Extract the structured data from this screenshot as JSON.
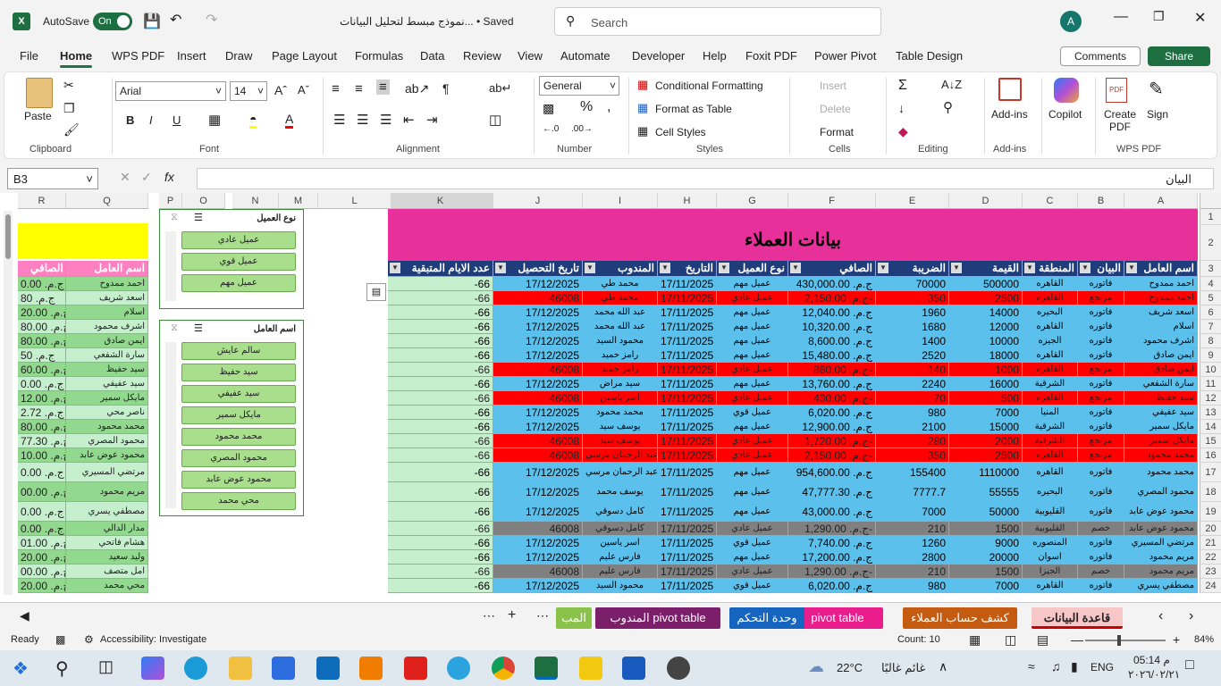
{
  "titlebar": {
    "autosave_label": "AutoSave",
    "autosave_state": "On",
    "doc_title": "نموذج مبسط لتحليل البيانات... • Saved",
    "search_placeholder": "Search",
    "user_initial": "A"
  },
  "menu": [
    "File",
    "Home",
    "WPS PDF",
    "Insert",
    "Draw",
    "Page Layout",
    "Formulas",
    "Data",
    "Review",
    "View",
    "Automate",
    "Developer",
    "Help",
    "Foxit PDF",
    "Power Pivot",
    "Table Design"
  ],
  "menu_active": "Home",
  "comments_label": "Comments",
  "share_label": "Share",
  "ribbon": {
    "paste": "Paste",
    "clipboard": "Clipboard",
    "font_name": "Arial",
    "font_size": "14",
    "font": "Font",
    "alignment": "Alignment",
    "number_format": "General",
    "number": "Number",
    "cond_format": "Conditional Formatting",
    "format_table": "Format as Table",
    "cell_styles": "Cell Styles",
    "styles": "Styles",
    "insert": "Insert",
    "delete": "Delete",
    "format": "Format",
    "cells": "Cells",
    "editing": "Editing",
    "addins": "Add-ins",
    "addins_group": "Add-ins",
    "copilot": "Copilot",
    "create_pdf": "Create PDF",
    "sign": "Sign",
    "wps_pdf": "WPS PDF",
    "bold": "B",
    "italic": "I",
    "underline": "U"
  },
  "formula": {
    "namebox": "B3",
    "content": "البيان"
  },
  "grid": {
    "right_cols": [
      {
        "id": "A",
        "w": 82
      },
      {
        "id": "B",
        "w": 52
      },
      {
        "id": "C",
        "w": 62
      },
      {
        "id": "D",
        "w": 82
      },
      {
        "id": "E",
        "w": 82
      },
      {
        "id": "F",
        "w": 98
      },
      {
        "id": "G",
        "w": 80
      },
      {
        "id": "H",
        "w": 66
      },
      {
        "id": "I",
        "w": 84
      },
      {
        "id": "J",
        "w": 100
      },
      {
        "id": "K",
        "w": 118
      }
    ],
    "title": "بيانات العملاء",
    "headers": [
      "اسم العامل",
      "البيان",
      "المنطقة",
      "القيمة",
      "الضريبة",
      "الصافي",
      "نوع العميل",
      "التاريخ",
      "المندوب",
      "تاريخ التحصيل",
      "عدد الايام المتبقية"
    ],
    "rows": [
      {
        "n": "4",
        "t": "b",
        "v": [
          "احمد ممدوح",
          "فاتوره",
          "القاهره",
          "500000",
          "70000",
          "ج.م. 430,000.00",
          "عميل مهم",
          "17/11/2025",
          "محمد طي",
          "17/12/2025",
          "-66"
        ]
      },
      {
        "n": "5",
        "t": "r",
        "v": [
          "احمد ممدوح",
          "مرتجع",
          "القاهره",
          "2500",
          "350",
          "ج.م. 2,150.00-",
          "عميل عادي",
          "17/11/2025",
          "محمد طي",
          "46008",
          "-66"
        ]
      },
      {
        "n": "6",
        "t": "b",
        "v": [
          "اسعد شريف",
          "فاتوره",
          "البحيره",
          "14000",
          "1960",
          "ج.م. 12,040.00",
          "عميل مهم",
          "17/11/2025",
          "عبد الله محمد",
          "17/12/2025",
          "-66"
        ]
      },
      {
        "n": "7",
        "t": "b",
        "v": [
          "اسلام",
          "فاتوره",
          "القاهره",
          "12000",
          "1680",
          "ج.م. 10,320.00",
          "عميل مهم",
          "17/11/2025",
          "عبد الله محمد",
          "17/12/2025",
          "-66"
        ]
      },
      {
        "n": "8",
        "t": "b",
        "v": [
          "اشرف محمود",
          "فاتوره",
          "الجيزه",
          "10000",
          "1400",
          "ج.م. 8,600.00",
          "عميل مهم",
          "17/11/2025",
          "محمود السيد",
          "17/12/2025",
          "-66"
        ]
      },
      {
        "n": "9",
        "t": "b",
        "v": [
          "ايمن صادق",
          "فاتوره",
          "القاهره",
          "18000",
          "2520",
          "ج.م. 15,480.00",
          "عميل مهم",
          "17/11/2025",
          "رامز حميد",
          "17/12/2025",
          "-66"
        ]
      },
      {
        "n": "10",
        "t": "r",
        "v": [
          "ايمن صادق",
          "مرتجع",
          "القاهره",
          "1000",
          "140",
          "ج.م. 860.00-",
          "عميل عادي",
          "17/11/2025",
          "رامز حميد",
          "46008",
          "-66"
        ]
      },
      {
        "n": "11",
        "t": "b",
        "v": [
          "سارة الشفعي",
          "فاتوره",
          "الشرقية",
          "16000",
          "2240",
          "ج.م. 13,760.00",
          "عميل مهم",
          "17/11/2025",
          "سيد مراض",
          "17/12/2025",
          "-66"
        ]
      },
      {
        "n": "12",
        "t": "r",
        "v": [
          "سيد حفيظ",
          "مرتجع",
          "القاهره",
          "500",
          "70",
          "ج.م. 430.00-",
          "عميل عادي",
          "17/11/2025",
          "اسر ياسين",
          "46008",
          "-66"
        ]
      },
      {
        "n": "13",
        "t": "b",
        "v": [
          "سيد عفيفي",
          "فاتوره",
          "المنيا",
          "7000",
          "980",
          "ج.م. 6,020.00",
          "عميل قوي",
          "17/11/2025",
          "محمد محمود",
          "17/12/2025",
          "-66"
        ]
      },
      {
        "n": "14",
        "t": "b",
        "v": [
          "مايكل سمير",
          "فاتوره",
          "الشرقية",
          "15000",
          "2100",
          "ج.م. 12,900.00",
          "عميل مهم",
          "17/11/2025",
          "يوسف سيد",
          "17/12/2025",
          "-66"
        ]
      },
      {
        "n": "15",
        "t": "r",
        "v": [
          "مايكل سمير",
          "مرتجع",
          "الشرقية",
          "2000",
          "280",
          "ج.م. 1,720.00-",
          "عميل عادي",
          "17/11/2025",
          "يوسف سيد",
          "46008",
          "-66"
        ]
      },
      {
        "n": "16",
        "t": "r",
        "v": [
          "محمد محمود",
          "مرتجع",
          "القاهره",
          "2500",
          "350",
          "ج.م. 2,150.00-",
          "عميل عادي",
          "17/11/2025",
          "عبد الرحمان مرسي",
          "46008",
          "-66"
        ]
      },
      {
        "n": "17",
        "t": "b",
        "v": [
          "محمد محمود",
          "فاتوره",
          "القاهره",
          "1110000",
          "155400",
          "ج.م. 954,600.00",
          "عميل مهم",
          "17/11/2025",
          "عبد الرحمان مرسي",
          "17/12/2025",
          "-66"
        ]
      },
      {
        "n": "18",
        "t": "b",
        "v": [
          "محمود المصري",
          "فاتوره",
          "البحيره",
          "55555",
          "7777.7",
          "ج.م. 47,777.30",
          "عميل مهم",
          "17/11/2025",
          "يوسف محمد",
          "17/12/2025",
          "-66"
        ]
      },
      {
        "n": "19",
        "t": "b",
        "v": [
          "محمود عوض عابد",
          "فاتوره",
          "القليوبية",
          "50000",
          "7000",
          "ج.م. 43,000.00",
          "عميل مهم",
          "17/11/2025",
          "كامل دسوقي",
          "17/12/2025",
          "-66"
        ]
      },
      {
        "n": "20",
        "t": "g",
        "v": [
          "محمود عوض عابد",
          "خصم",
          "القليوبية",
          "1500",
          "210",
          "ج.م. 1,290.00-",
          "عميل عادي",
          "17/11/2025",
          "كامل دسوقي",
          "46008",
          "-66"
        ]
      },
      {
        "n": "21",
        "t": "b",
        "v": [
          "مرتضي المسيري",
          "فاتوره",
          "المنصوره",
          "9000",
          "1260",
          "ج.م. 7,740.00",
          "عميل قوي",
          "17/11/2025",
          "اسر ياسين",
          "17/12/2025",
          "-66"
        ]
      },
      {
        "n": "22",
        "t": "b",
        "v": [
          "مريم محمود",
          "فاتوره",
          "اسوان",
          "20000",
          "2800",
          "ج.م. 17,200.00",
          "عميل مهم",
          "17/11/2025",
          "فارس عليم",
          "17/12/2025",
          "-66"
        ]
      },
      {
        "n": "23",
        "t": "g",
        "v": [
          "مريم محمود",
          "خصم",
          "الجيزا",
          "1500",
          "210",
          "ج.م. 1,290.00-",
          "عميل عادي",
          "17/11/2025",
          "فارس عليم",
          "46008",
          "-66"
        ]
      },
      {
        "n": "24",
        "t": "b",
        "v": [
          "مصطفي يسري",
          "فاتوره",
          "القاهره",
          "7000",
          "980",
          "ج.م. 6,020.00",
          "عميل قوي",
          "17/11/2025",
          "محمود السيد",
          "17/12/2025",
          "-66"
        ]
      }
    ],
    "left_cols": [
      {
        "id": "Q",
        "w": 92
      },
      {
        "id": "R",
        "w": 54
      }
    ],
    "left_headers": [
      "اسم العامل",
      "الصافي"
    ],
    "left_rows": [
      [
        "احمد ممدوح",
        "ج.م. 0.00"
      ],
      [
        "اسعد شريف",
        "ج.م. 80"
      ],
      [
        "اسلام",
        "ج.م. 20.00"
      ],
      [
        "اشرف محمود",
        "ج.م. 80.00"
      ],
      [
        "ايمن صادق",
        "ج.م. 80.00"
      ],
      [
        "سارة الشفعي",
        "ج.م. 50"
      ],
      [
        "سيد حفيظ",
        "ج.م. 60.00"
      ],
      [
        "سيد عفيفي",
        "ج.م. 0.00"
      ],
      [
        "مايكل سمير",
        "ج.م. 12.00"
      ],
      [
        "ناصر محي",
        "ج.م. 2.72"
      ],
      [
        "محمد محمود",
        "ج.م. 80.00"
      ],
      [
        "محمود المصري",
        "ج.م. 77.30"
      ],
      [
        "محمود عوض عابد",
        "ج.م. 10.00"
      ],
      [
        "مرتضي المسيري",
        "ج.م. 0.00"
      ],
      [
        "مريم محمود",
        "ج.م. 00.00"
      ],
      [
        "مصطفي يسري",
        "ج.م. 0.00"
      ],
      [
        "مدار الدالي",
        "ج.م. 0.00"
      ],
      [
        "هشام فاتحي",
        "ج.م. 01.00"
      ],
      [
        "وليد سعيد",
        "ج.م. 20.00"
      ],
      [
        "امل متصف",
        "ج.م. 00.00"
      ],
      [
        "محي محمد",
        "ج.م. 20.00"
      ]
    ],
    "mid_cols": [
      "P",
      "O",
      "N",
      "M",
      "L"
    ]
  },
  "slicer1": {
    "title": "نوع العميل",
    "items": [
      "عميل عادي",
      "عميل قوي",
      "عميل مهم"
    ]
  },
  "slicer2": {
    "title": "اسم العامل",
    "items": [
      "سالم عايش",
      "سيد حفيظ",
      "سيد عفيفي",
      "مايكل سمير",
      "محمد محمود",
      "محمود المصري",
      "محمود عوض عابد",
      "محي محمد"
    ]
  },
  "tabs": [
    {
      "label": "قاعدة البيانات",
      "color": "#f7c6c6",
      "fg": "#222"
    },
    {
      "label": "كشف حساب العملاء",
      "color": "#c55a11",
      "fg": "#fff"
    },
    {
      "label": "pivot table",
      "color": "#e91e8c",
      "fg": "#fff"
    },
    {
      "label": "وحدة التحكم",
      "color": "#1565c0",
      "fg": "#fff"
    },
    {
      "label": "المندوب pivot table",
      "color": "#7b1f6a",
      "fg": "#fff"
    },
    {
      "label": "المب",
      "color": "#8bc34a",
      "fg": "#fff"
    }
  ],
  "status": {
    "ready": "Ready",
    "accessibility": "Accessibility: Investigate",
    "count": "Count: 10",
    "zoom": "84%"
  },
  "taskbar": {
    "weather": "22°C",
    "weather_desc": "غائم غالبًا",
    "lang": "ENG",
    "time": "05:14 م",
    "date": "٢٠٢٦/٠٢/٢١"
  },
  "colors": {
    "blue": "#5bc0eb",
    "red": "#ff0000",
    "gray": "#808080",
    "title_bg": "#e8309a",
    "header_bg": "#1f3d7a",
    "green_row": "#c6efce"
  }
}
